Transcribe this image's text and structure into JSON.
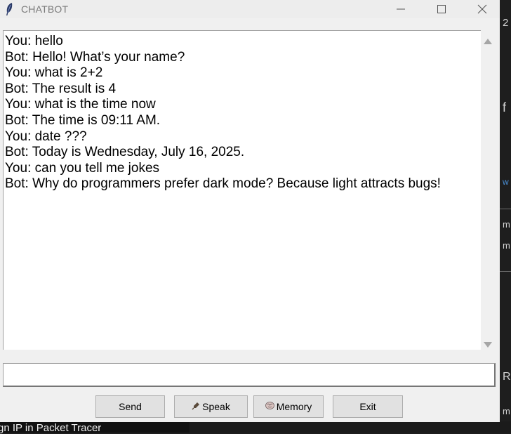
{
  "window": {
    "title": "CHATBOT"
  },
  "chat": {
    "messages": [
      "You: hello",
      "Bot: Hello! What’s your name?",
      "You: what is 2+2",
      "Bot: The result is 4",
      "You: what is the time now",
      "Bot: The time is 09:11 AM.",
      "You: date ???",
      "Bot: Today is Wednesday, July 16, 2025.",
      "You: can you tell me jokes",
      "Bot: Why do programmers prefer dark mode? Because light attracts bugs!"
    ]
  },
  "input": {
    "value": ""
  },
  "buttons": {
    "send": "Send",
    "speak": "Speak",
    "memory": "Memory",
    "exit": "Exit"
  },
  "icons": {
    "app": "feather-icon",
    "speak": "microphone-icon",
    "memory": "brain-icon"
  },
  "background": {
    "fragments": [
      "2",
      "f",
      "w",
      "m",
      "m",
      "R",
      "m"
    ],
    "bottom_text": "gn IP in Packet Tracer"
  }
}
